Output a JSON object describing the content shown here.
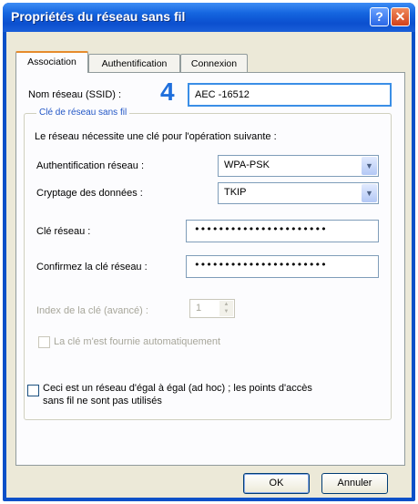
{
  "window": {
    "title": "Propriétés du réseau sans fil",
    "help_glyph": "?",
    "close_glyph": "✕"
  },
  "tabs": [
    {
      "label": "Association",
      "active": true
    },
    {
      "label": "Authentification",
      "active": false
    },
    {
      "label": "Connexion",
      "active": false
    }
  ],
  "association": {
    "ssid_label": "Nom réseau (SSID) :",
    "ssid_value": "AEC -16512",
    "step_marker": "4",
    "group_title": "Clé de réseau sans fil",
    "requires_key_text": "Le réseau nécessite une clé pour l'opération suivante :",
    "auth_label": "Authentification réseau :",
    "auth_value": "WPA-PSK",
    "encryption_label": "Cryptage des données :",
    "encryption_value": "TKIP",
    "key_label": "Clé réseau :",
    "key_value": "••••••••••••••••••••••",
    "confirm_label": "Confirmez la clé réseau :",
    "confirm_value": "••••••••••••••••••••••",
    "key_index_label": "Index de la clé (avancé) :",
    "key_index_value": "1",
    "auto_key_label": "La clé m'est fournie automatiquement",
    "adhoc_label_line1": "Ceci est un réseau d'égal à égal (ad hoc) ; les points d'accès",
    "adhoc_label_line2": "sans fil ne sont pas utilisés"
  },
  "buttons": {
    "ok": "OK",
    "cancel": "Annuler"
  },
  "colors": {
    "titlebar": "#0a50c8",
    "accent_blue": "#1f6fdc",
    "dialog_bg": "#ece9d8"
  }
}
